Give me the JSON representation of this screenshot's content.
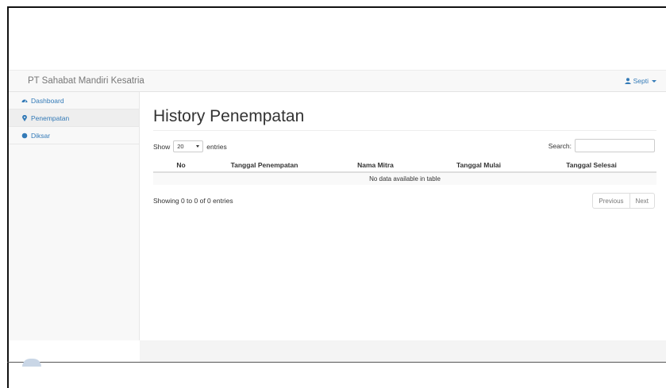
{
  "navbar": {
    "brand": "PT Sahabat Mandiri Kesatria",
    "user": "Septi",
    "user_icon": "user-icon"
  },
  "sidebar": {
    "items": [
      {
        "label": "Dashboard",
        "icon": "dashboard-icon",
        "active": false
      },
      {
        "label": "Penempatan",
        "icon": "map-marker-icon",
        "active": true
      },
      {
        "label": "Diksar",
        "icon": "circle-icon",
        "active": false
      }
    ]
  },
  "main": {
    "title": "History Penempatan",
    "show_label": "Show",
    "entries_label": "entries",
    "page_size": "20",
    "search_label": "Search:",
    "search_value": "",
    "table": {
      "columns": [
        "No",
        "Tanggal Penempatan",
        "Nama Mitra",
        "Tanggal Mulai",
        "Tanggal Selesai"
      ],
      "empty_message": "No data available in table"
    },
    "info": "Showing 0 to 0 of 0 entries",
    "pager": {
      "previous": "Previous",
      "next": "Next"
    }
  },
  "colors": {
    "link": "#337ab7",
    "navbar_bg": "#f8f8f8",
    "active_bg": "#eeeeee"
  }
}
